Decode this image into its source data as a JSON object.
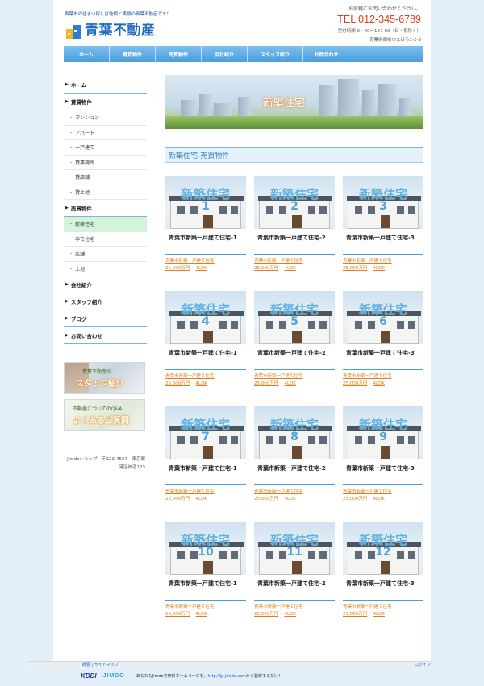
{
  "header": {
    "tagline": "青葉市の住まい探しは信頼と実績の青葉不動産です！",
    "logo_text": "青葉不動産",
    "inquiry": "お気軽にお問い合わせください。",
    "tel": "TEL 012-345-6789",
    "hours": "受付時間 9：00～18：00（日・祝除く）",
    "address": "青葉県都県市まほろ1-2-3"
  },
  "nav": [
    "ホーム",
    "賃貸物件",
    "売買物件",
    "会社紹介",
    "スタッフ紹介",
    "お問合わせ"
  ],
  "sidebar": {
    "home": "ホーム",
    "rental": "賃貸物件",
    "rental_items": [
      "マンション",
      "アパート",
      "一戸建て",
      "貸事務所",
      "貸店舗",
      "貸土地"
    ],
    "sale": "売買物件",
    "sale_items": [
      "新築住宅",
      "中古住宅",
      "店舗",
      "土地"
    ],
    "company": "会社紹介",
    "staff": "スタッフ紹介",
    "blog": "ブログ",
    "contact": "お問い合わせ",
    "banner1_small": "青葉不動産の",
    "banner1_big": "スタッフ紹介",
    "banner2_small": "不動産についてのQ&A",
    "banner2_big": "よくあるご質問",
    "shop_line1": "Jimdoショップ　〒123-4567　東京都",
    "shop_line2": "港区神道123"
  },
  "main": {
    "hero_title": "新築住宅",
    "section_title": "新築住宅-売買物件",
    "thumb_label": "新築住宅",
    "cards": [
      {
        "num": "1",
        "title": "青葉市新築一戸建て住宅-1",
        "desc": "青葉市新築一戸建て住宅",
        "price": "25,000万円",
        "layout": "4LDK"
      },
      {
        "num": "2",
        "title": "青葉市新築一戸建て住宅-2",
        "desc": "青葉市新築一戸建て住宅",
        "price": "25,000万円",
        "layout": "4LDK"
      },
      {
        "num": "3",
        "title": "青葉市新築一戸建て住宅-3",
        "desc": "青葉市新築一戸建て住宅",
        "price": "25,000万円",
        "layout": "4LDK"
      },
      {
        "num": "4",
        "title": "青葉市新築一戸建て住宅-1",
        "desc": "青葉市新築一戸建て住宅",
        "price": "25,000万円",
        "layout": "4LDK"
      },
      {
        "num": "5",
        "title": "青葉市新築一戸建て住宅-2",
        "desc": "青葉市新築一戸建て住宅",
        "price": "25,000万円",
        "layout": "4LDK"
      },
      {
        "num": "6",
        "title": "青葉市新築一戸建て住宅-3",
        "desc": "青葉市新築一戸建て住宅",
        "price": "25,000万円",
        "layout": "4LDK"
      },
      {
        "num": "7",
        "title": "青葉市新築一戸建て住宅-1",
        "desc": "青葉市新築一戸建て住宅",
        "price": "25,000万円",
        "layout": "4LDK"
      },
      {
        "num": "8",
        "title": "青葉市新築一戸建て住宅-2",
        "desc": "青葉市新築一戸建て住宅",
        "price": "25,000万円",
        "layout": "4LDK"
      },
      {
        "num": "9",
        "title": "青葉市新築一戸建て住宅-3",
        "desc": "青葉市新築一戸建て住宅",
        "price": "25,000万円",
        "layout": "4LDK"
      },
      {
        "num": "10",
        "title": "青葉市新築一戸建て住宅-1",
        "desc": "青葉市新築一戸建て住宅",
        "price": "25,000万円",
        "layout": "4LDK"
      },
      {
        "num": "11",
        "title": "青葉市新築一戸建て住宅-2",
        "desc": "青葉市新築一戸建て住宅",
        "price": "25,000万円",
        "layout": "4LDK"
      },
      {
        "num": "12",
        "title": "青葉市新築一戸建て住宅-3",
        "desc": "青葉市新築一戸建て住宅",
        "price": "25,000万円",
        "layout": "4LDK"
      }
    ]
  },
  "footer": {
    "links": "概要 | サイトマップ",
    "login": "ログイン",
    "kddi": "KDDI",
    "jimdo": "JIMDO",
    "promo": "あなたもJimdoで無料ホームページを。",
    "promo_link": "http://jp.jimdo.com",
    "promo_tail": "から登録するだけ！"
  }
}
